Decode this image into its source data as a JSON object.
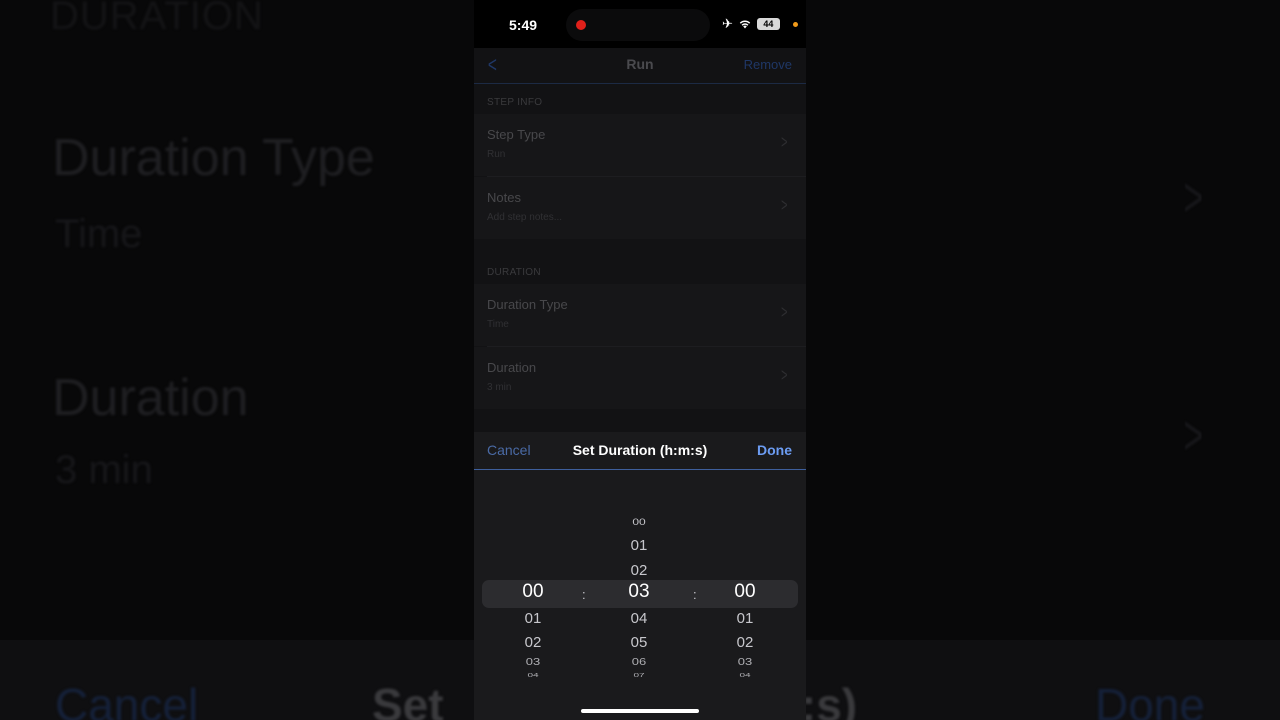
{
  "background": {
    "title": "DURATION",
    "duration_type_label": "Duration Type",
    "duration_type_value": "Time",
    "duration_label": "Duration",
    "duration_value": "3 min",
    "cancel": "Cancel",
    "set_prefix": "Set",
    "set_suffix": "m:s)",
    "done": "Done"
  },
  "status_bar": {
    "time": "5:49",
    "battery": "44",
    "recording": true
  },
  "nav": {
    "title": "Run",
    "remove_label": "Remove"
  },
  "sections": [
    {
      "header": "STEP INFO",
      "rows": [
        {
          "title": "Step Type",
          "subtitle": "Run"
        },
        {
          "title": "Notes",
          "subtitle": "Add step notes..."
        }
      ]
    },
    {
      "header": "DURATION",
      "rows": [
        {
          "title": "Duration Type",
          "subtitle": "Time"
        },
        {
          "title": "Duration",
          "subtitle": "3 min"
        }
      ]
    }
  ],
  "sheet": {
    "cancel_label": "Cancel",
    "title": "Set Duration (h:m:s)",
    "done_label": "Done"
  },
  "picker": {
    "separator": ":",
    "hours": {
      "above": [],
      "selected": "00",
      "below": [
        "01",
        "02",
        "03",
        "04"
      ]
    },
    "minutes": {
      "above": [
        "00",
        "01",
        "02"
      ],
      "selected": "03",
      "below": [
        "04",
        "05",
        "06",
        "07"
      ]
    },
    "seconds": {
      "above": [],
      "selected": "00",
      "below": [
        "01",
        "02",
        "03",
        "04"
      ]
    }
  },
  "colors": {
    "accent": "#6c9cf2",
    "recording": "#e0201a",
    "privacy_dot": "#f09a1a"
  }
}
